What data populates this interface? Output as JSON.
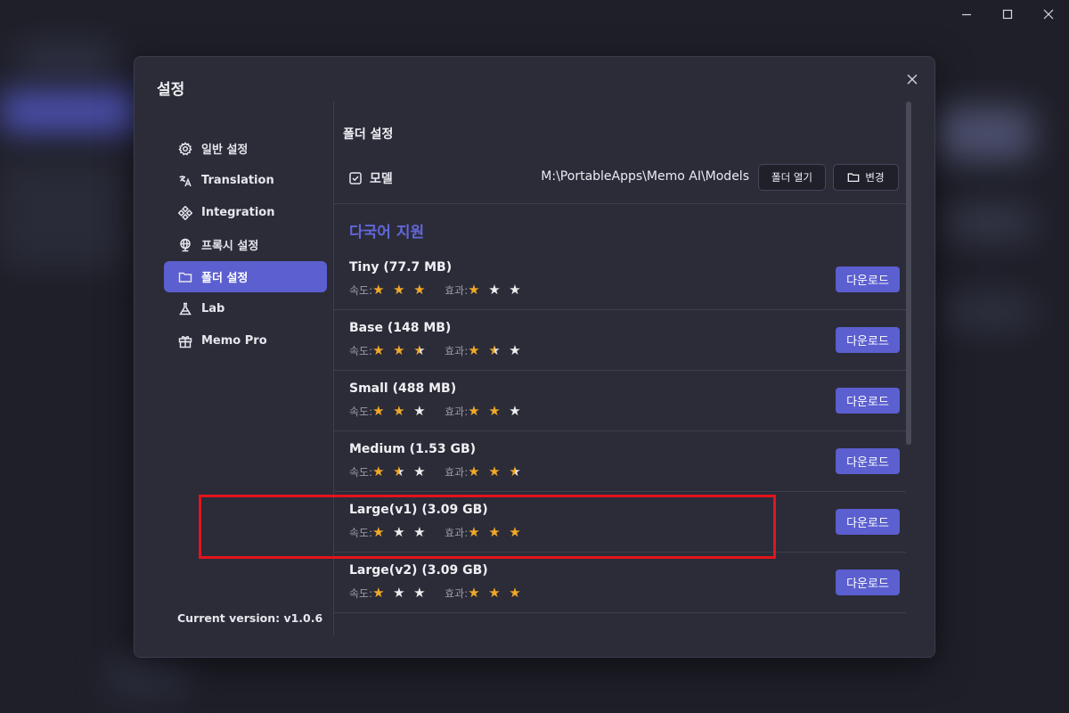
{
  "window_controls": {
    "minimize": "minimize-icon",
    "maximize": "maximize-icon",
    "close": "close-icon"
  },
  "modal": {
    "title": "설정",
    "close_icon": "close-icon"
  },
  "sidebar": {
    "items": [
      {
        "label": "일반 설정",
        "icon": "gear-icon",
        "active": false
      },
      {
        "label": "Translation",
        "icon": "translate-icon",
        "active": false
      },
      {
        "label": "Integration",
        "icon": "integration-icon",
        "active": false
      },
      {
        "label": "프록시 설정",
        "icon": "globe-icon",
        "active": false
      },
      {
        "label": "폴더 설정",
        "icon": "folder-icon",
        "active": true
      },
      {
        "label": "Lab",
        "icon": "flask-icon",
        "active": false
      },
      {
        "label": "Memo Pro",
        "icon": "gift-icon",
        "active": false
      }
    ],
    "version": "Current version: v1.0.6"
  },
  "content": {
    "section_title": "폴더 설정",
    "folder": {
      "label": "모델",
      "path": "M:\\PortableApps\\Memo AI\\Models",
      "open_label": "폴더 열기",
      "change_label": "변경"
    },
    "multi_title": "다국어 지원",
    "speed_label": "속도:",
    "effect_label": "효과:",
    "download_label": "다운로드",
    "models": [
      {
        "name": "Tiny (77.7 MB)",
        "speed": 3,
        "effect": 1
      },
      {
        "name": "Base (148 MB)",
        "speed": 2.5,
        "effect": 1.5
      },
      {
        "name": "Small (488 MB)",
        "speed": 2,
        "effect": 2
      },
      {
        "name": "Medium (1.53 GB)",
        "speed": 1.5,
        "effect": 2.5
      },
      {
        "name": "Large(v1) (3.09 GB)",
        "speed": 1,
        "effect": 3
      },
      {
        "name": "Large(v2) (3.09 GB)",
        "speed": 1,
        "effect": 3
      }
    ]
  },
  "colors": {
    "accent": "#5b5fcf",
    "star": "#f2a928",
    "highlight": "#e3141c",
    "section": "#6267d8"
  }
}
